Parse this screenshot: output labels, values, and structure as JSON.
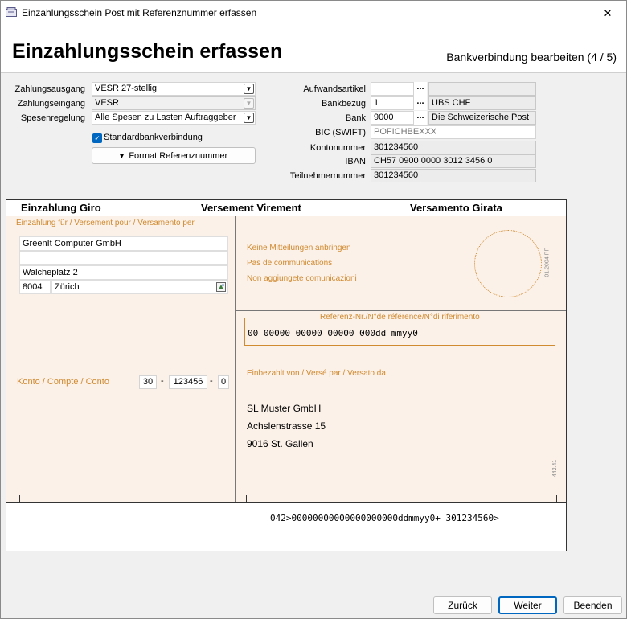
{
  "window": {
    "title": "Einzahlungsschein Post mit Referenznummer erfassen",
    "minimize": "—",
    "close": "✕"
  },
  "header": {
    "title": "Einzahlungsschein erfassen",
    "step": "Bankverbindung bearbeiten (4 / 5)"
  },
  "left_form": {
    "zahlungsausgang_label": "Zahlungsausgang",
    "zahlungsausgang_value": "VESR 27-stellig",
    "zahlungseingang_label": "Zahlungseingang",
    "zahlungseingang_value": "VESR",
    "spesen_label": "Spesenregelung",
    "spesen_value": "Alle Spesen zu Lasten Auftraggeber",
    "standard_checkbox_label": "Standardbankverbindung",
    "standard_checked": true,
    "format_button_label": "Format Referenznummer",
    "format_button_icon": "▾"
  },
  "right_form": {
    "aufwand_label": "Aufwandsartikel",
    "aufwand_value": "",
    "aufwand_desc": "",
    "bankbezug_label": "Bankbezug",
    "bankbezug_value": "1",
    "bankbezug_desc": "UBS CHF",
    "bank_label": "Bank",
    "bank_value": "9000",
    "bank_desc": "Die Schweizerische Post",
    "bic_label": "BIC (SWIFT)",
    "bic_value": "POFICHBEXXX",
    "konto_label": "Kontonummer",
    "konto_value": "301234560",
    "iban_label": "IBAN",
    "iban_value": "CH57 0900 0000 3012 3456 0",
    "teilnehmer_label": "Teilnehmernummer",
    "teilnehmer_value": "301234560",
    "dots": "..."
  },
  "slip": {
    "h1": "Einzahlung Giro",
    "h2": "Versement Virement",
    "h3": "Versamento Girata",
    "einzahlung_fuer": "Einzahlung für / Versement pour / Versamento per",
    "addr1": "GreenIt Computer GmbH",
    "addr2": "",
    "addr3": "Walcheplatz 2",
    "plz": "8004",
    "ort": "Zürich",
    "mitteilung1": "Keine Mitteilungen anbringen",
    "mitteilung2": "Pas de communications",
    "mitteilung3": "Non aggiungete comunicazioni",
    "form_code": "01.2004 PF",
    "referenz_label": "Referenz-Nr./N°de référence/N°di riferimento",
    "referenz_value": "00 00000 00000 00000 000dd mmyy0",
    "konto_label": "Konto / Compte / Conto",
    "konto_a": "30",
    "konto_b": "123456",
    "konto_c": "0",
    "dash": "-",
    "einbezahlt_label": "Einbezahlt von / Versé par / Versato da",
    "payer1": "SL Muster GmbH",
    "payer2": "Achslenstrasse 15",
    "payer3": "9016 St. Gallen",
    "side_code": "442.41",
    "ocr_line": "042>00000000000000000000ddmmyy0+ 301234560>"
  },
  "footer": {
    "back": "Zurück",
    "next": "Weiter",
    "end": "Beenden"
  }
}
